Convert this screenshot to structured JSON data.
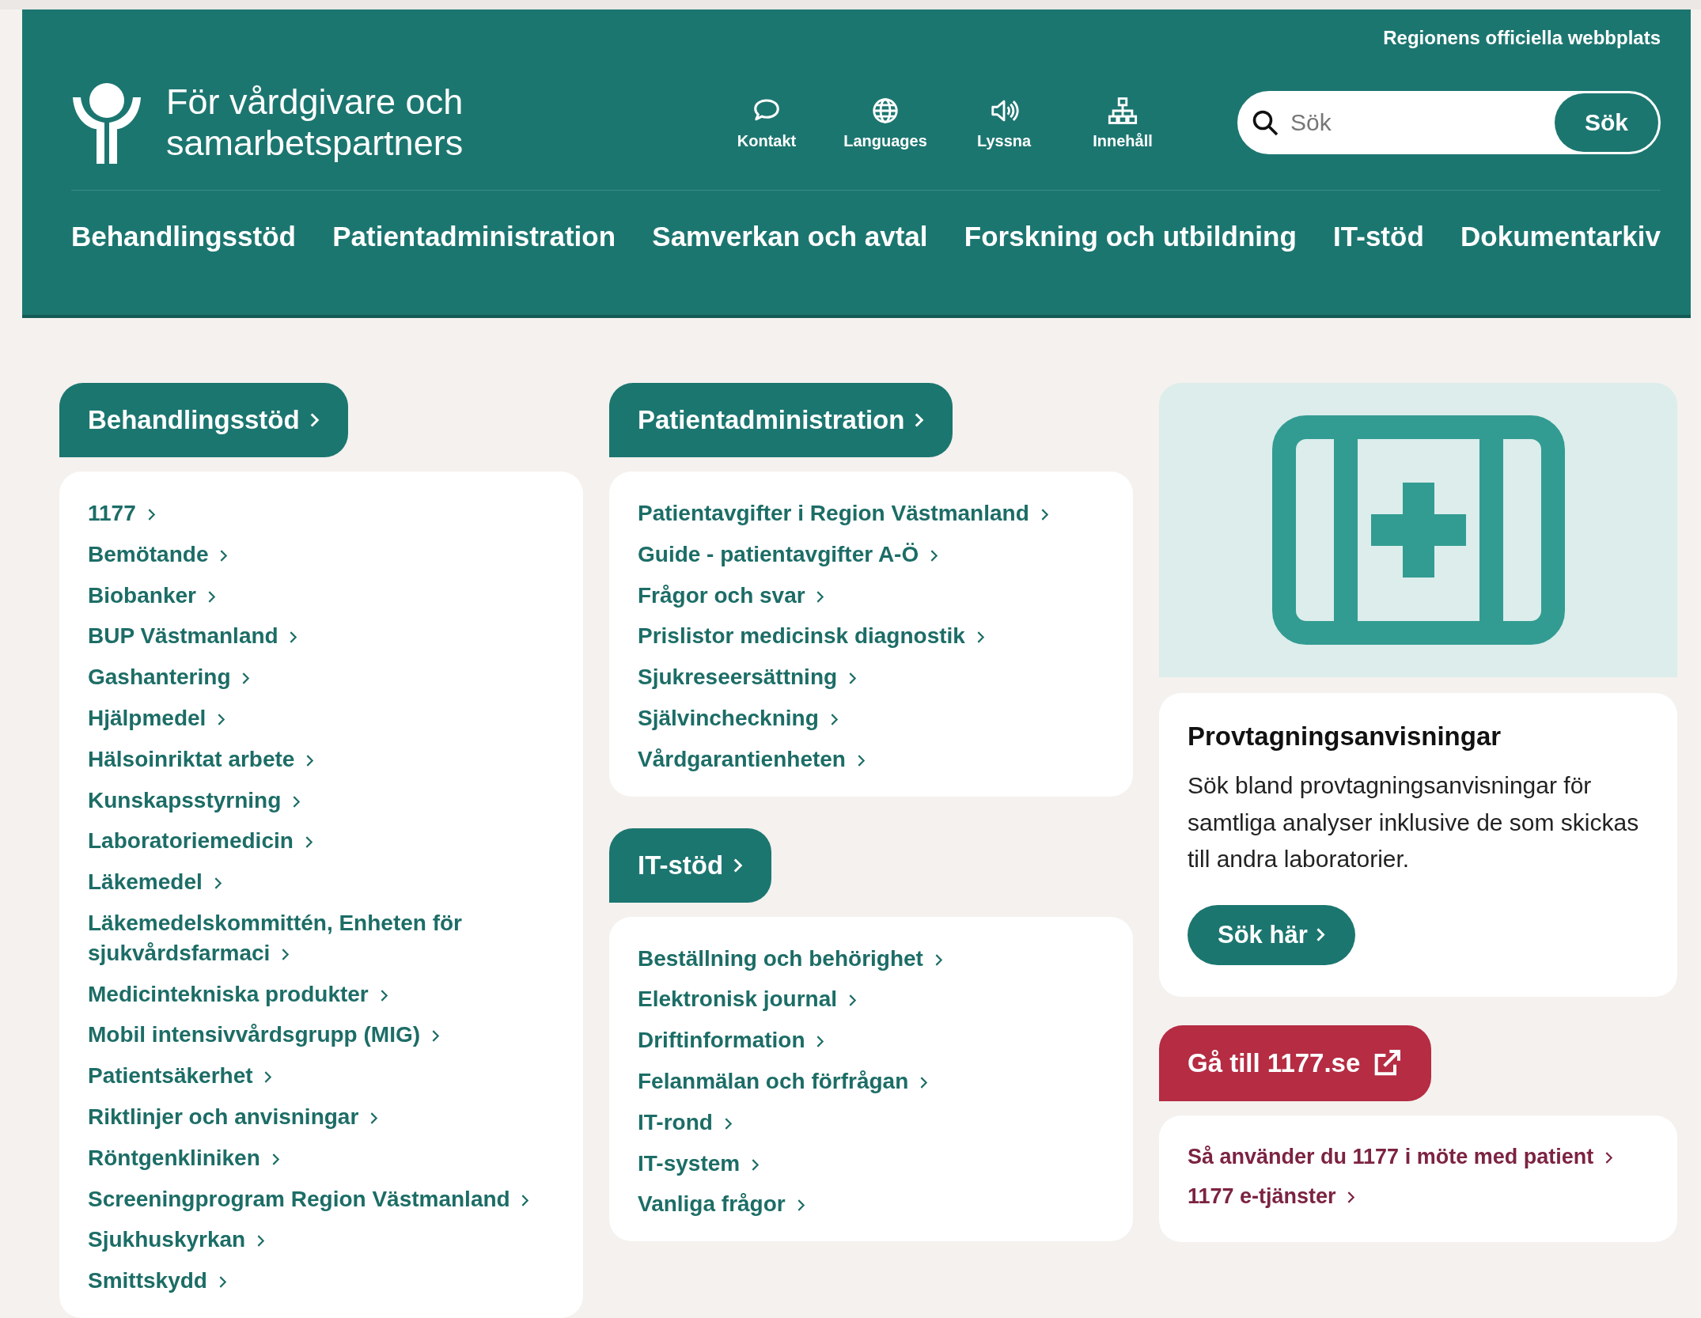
{
  "header": {
    "notice": "Regionens officiella webbplats",
    "title": "För vårdgivare och samarbetspartners",
    "tools": [
      {
        "kind": "chat",
        "label": "Kontakt"
      },
      {
        "kind": "globe",
        "label": "Languages"
      },
      {
        "kind": "speaker",
        "label": "Lyssna"
      },
      {
        "kind": "sitemap",
        "label": "Innehåll"
      }
    ],
    "search": {
      "placeholder": "Sök",
      "button": "Sök"
    },
    "nav": [
      "Behandlingsstöd",
      "Patientadministration",
      "Samverkan och avtal",
      "Forskning och utbildning",
      "IT-stöd",
      "Dokumentarkiv"
    ]
  },
  "columns": [
    {
      "sections": [
        {
          "title": "Behandlingsstöd",
          "links": [
            "1177",
            "Bemötande",
            "Biobanker",
            "BUP Västmanland",
            "Gashantering",
            "Hjälpmedel",
            "Hälsoinriktat arbete",
            "Kunskapsstyrning",
            "Laboratoriemedicin",
            "Läkemedel",
            "Läkemedelskommittén, Enheten för sjukvårdsfarmaci",
            "Medicintekniska produkter",
            "Mobil intensivvårdsgrupp (MIG)",
            "Patientsäkerhet",
            "Riktlinjer och anvisningar",
            "Röntgenkliniken",
            "Screeningprogram Region Västmanland",
            "Sjukhuskyrkan",
            "Smittskydd"
          ]
        }
      ]
    },
    {
      "sections": [
        {
          "title": "Patientadministration",
          "links": [
            "Patientavgifter i Region Västmanland",
            "Guide - patientavgifter A-Ö",
            "Frågor och svar",
            "Prislistor medicinsk diagnostik",
            "Sjukreseersättning",
            "Självincheckning",
            "Vårdgarantienheten"
          ]
        },
        {
          "title": "IT-stöd",
          "links": [
            "Beställning och behörighet",
            "Elektronisk journal",
            "Driftinformation",
            "Felanmälan och förfrågan",
            "IT-rond",
            "IT-system",
            "Vanliga frågor"
          ]
        }
      ]
    }
  ],
  "promo": {
    "title": "Provtagningsanvisningar",
    "text": "Sök bland provtagningsanvisningar för samtliga analyser inklusive de som skickas till andra laboratorier.",
    "button": "Sök här"
  },
  "external_button": "Gå till 1177.se",
  "related_links": [
    "Så använder du 1177 i möte med patient",
    "1177 e-tjänster"
  ]
}
